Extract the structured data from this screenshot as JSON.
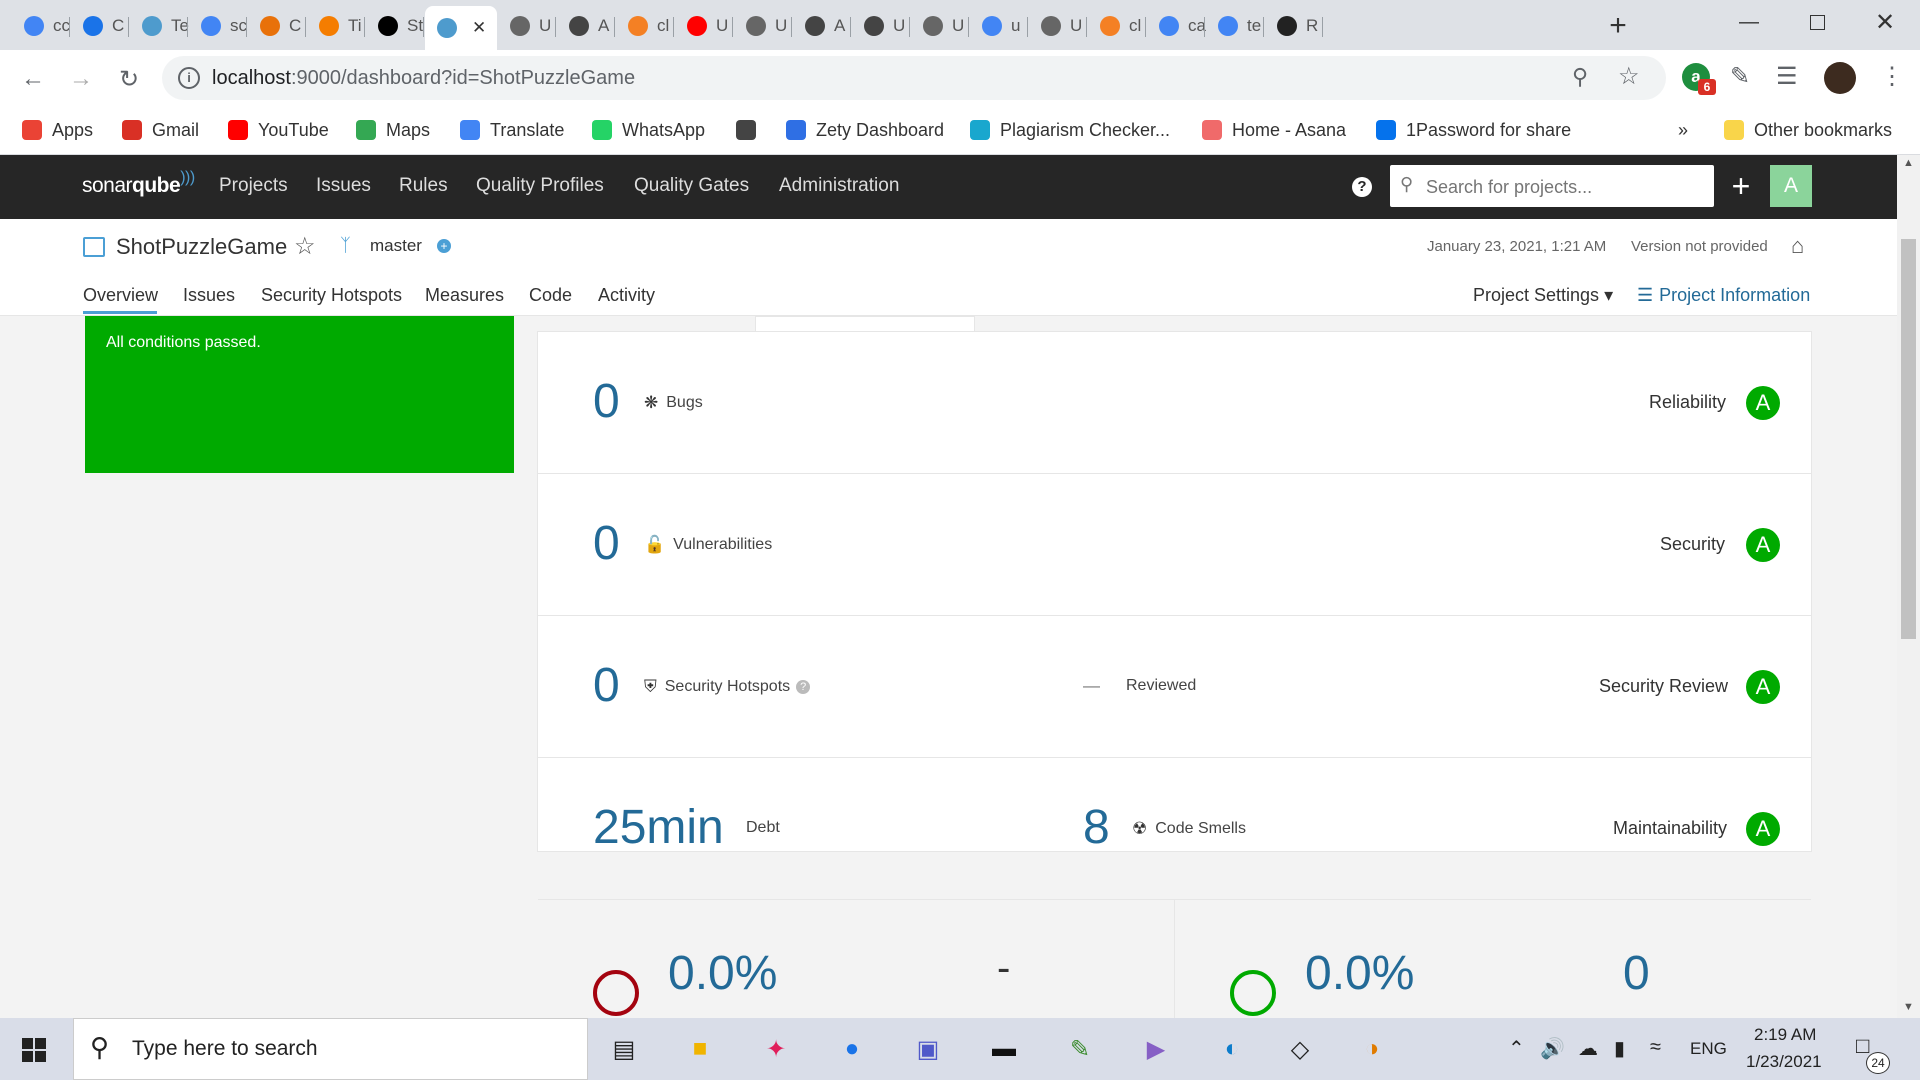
{
  "browser": {
    "tabs": [
      {
        "label": "cc",
        "icon": "google-icon",
        "color": "#4285f4"
      },
      {
        "label": "C",
        "icon": "hand-icon",
        "color": "#1a73e8"
      },
      {
        "label": "Te",
        "icon": "sonar-icon",
        "color": "#4e9bcd"
      },
      {
        "label": "sc",
        "icon": "google-icon",
        "color": "#4285f4"
      },
      {
        "label": "C",
        "icon": "chrome-icon",
        "color": "#e8710a"
      },
      {
        "label": "Ti",
        "icon": "blogger-icon",
        "color": "#f57d00"
      },
      {
        "label": "St",
        "icon": "medium-icon",
        "color": "#000000"
      },
      {
        "label": "",
        "icon": "sonar-icon",
        "color": "#4e9bcd",
        "active": true
      },
      {
        "label": "U",
        "icon": "unity-icon",
        "color": "#666666"
      },
      {
        "label": "A",
        "icon": "unity-answers-icon",
        "color": "#444444"
      },
      {
        "label": "cl",
        "icon": "stackoverflow-icon",
        "color": "#f48024"
      },
      {
        "label": "U",
        "icon": "youtube-icon",
        "color": "#ff0000"
      },
      {
        "label": "U",
        "icon": "unity-icon",
        "color": "#666666"
      },
      {
        "label": "A",
        "icon": "unity-answers-icon",
        "color": "#444444"
      },
      {
        "label": "U",
        "icon": "unity-answers-icon",
        "color": "#444444"
      },
      {
        "label": "U",
        "icon": "unity-icon",
        "color": "#666666"
      },
      {
        "label": "u",
        "icon": "google-icon",
        "color": "#4285f4"
      },
      {
        "label": "U",
        "icon": "unity-icon",
        "color": "#666666"
      },
      {
        "label": "cl",
        "icon": "stackoverflow-icon",
        "color": "#f48024"
      },
      {
        "label": "ca",
        "icon": "google-icon",
        "color": "#4285f4"
      },
      {
        "label": "te",
        "icon": "google-icon",
        "color": "#4285f4"
      },
      {
        "label": "R",
        "icon": "unity-icon",
        "color": "#222222"
      }
    ],
    "url_host": "localhost",
    "url_path": ":9000/dashboard?id=ShotPuzzleGame",
    "extension_badge": "6",
    "bookmarks": [
      {
        "label": "Apps",
        "icon": "apps-grid-icon",
        "color": "#ea4335"
      },
      {
        "label": "Gmail",
        "icon": "gmail-icon",
        "color": "#d93025"
      },
      {
        "label": "YouTube",
        "icon": "youtube-icon",
        "color": "#ff0000"
      },
      {
        "label": "Maps",
        "icon": "maps-pin-icon",
        "color": "#34a853"
      },
      {
        "label": "Translate",
        "icon": "translate-icon",
        "color": "#4285f4"
      },
      {
        "label": "WhatsApp",
        "icon": "whatsapp-icon",
        "color": "#25d366"
      },
      {
        "label": "",
        "icon": "globe-icon",
        "color": "#444444"
      },
      {
        "label": "Zety Dashboard",
        "icon": "zety-icon",
        "color": "#2f6fe4"
      },
      {
        "label": "Plagiarism Checker...",
        "icon": "plagiarism-icon",
        "color": "#19a7ce"
      },
      {
        "label": "Home - Asana",
        "icon": "asana-icon",
        "color": "#f06a6a"
      },
      {
        "label": "1Password for share",
        "icon": "onepassword-icon",
        "color": "#0572ec"
      }
    ],
    "more_bookmarks": "»",
    "other_bookmarks": "Other bookmarks"
  },
  "sonar": {
    "logo_a": "sonar",
    "logo_b": "qube",
    "nav": [
      "Projects",
      "Issues",
      "Rules",
      "Quality Profiles",
      "Quality Gates",
      "Administration"
    ],
    "help": "?",
    "search_placeholder": "Search for projects...",
    "plus": "+",
    "avatar": "A",
    "project": {
      "name": "ShotPuzzleGame",
      "branch": "master",
      "date": "January 23, 2021, 1:21 AM",
      "version": "Version not provided",
      "tabs": [
        "Overview",
        "Issues",
        "Security Hotspots",
        "Measures",
        "Code",
        "Activity"
      ],
      "settings": "Project Settings",
      "info": "Project Information"
    },
    "quality_gate": "All conditions passed.",
    "measures": {
      "bugs": {
        "value": "0",
        "label": "Bugs",
        "rating_title": "Reliability",
        "rating": "A"
      },
      "vulnerabilities": {
        "value": "0",
        "label": "Vulnerabilities",
        "rating_title": "Security",
        "rating": "A"
      },
      "hotspots": {
        "value": "0",
        "label": "Security Hotspots",
        "reviewed_value": "—",
        "reviewed_label": "Reviewed",
        "rating_title": "Security Review",
        "rating": "A"
      },
      "debt": {
        "value": "25min",
        "label": "Debt",
        "smells_value": "8",
        "smells_label": "Code Smells",
        "rating_title": "Maintainability",
        "rating": "A"
      },
      "coverage": {
        "value": "0.0%",
        "unit_tests": "-"
      },
      "duplications": {
        "value": "0.0%",
        "blocks": "0"
      }
    },
    "colors": {
      "pass": "#00aa00",
      "link": "#236a97",
      "coverage_ring": "#a4030f",
      "dup_ring": "#00aa00"
    }
  },
  "taskbar": {
    "search_placeholder": "Type here to search",
    "language": "ENG",
    "time": "2:19 AM",
    "date": "1/23/2021",
    "notifications": "24",
    "apps": [
      "task-view-icon",
      "file-explorer-icon",
      "slack-icon",
      "chrome-icon",
      "teams-icon",
      "terminal-icon",
      "notepad-icon",
      "visual-studio-icon",
      "edge-icon",
      "unity-icon",
      "paint-icon"
    ]
  }
}
